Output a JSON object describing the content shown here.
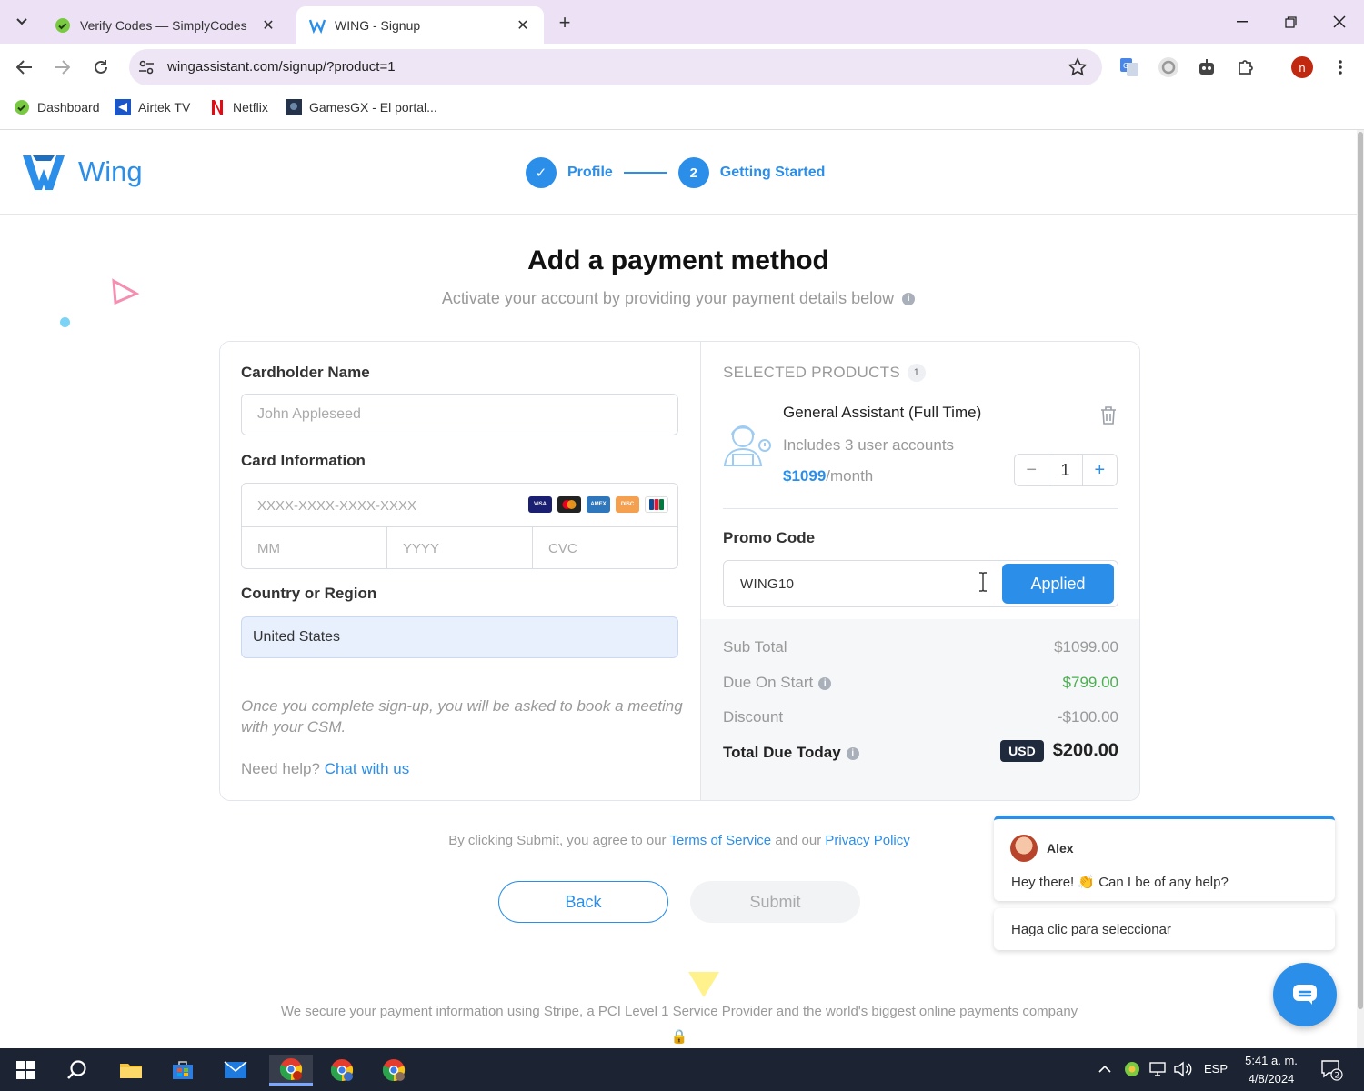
{
  "browser": {
    "tabs": [
      {
        "title": "Verify Codes — SimplyCodes",
        "active": false
      },
      {
        "title": "WING - Signup",
        "active": true
      }
    ],
    "url": "wingassistant.com/signup/?product=1",
    "profile_initial": "n",
    "bookmarks": [
      {
        "label": "Dashboard",
        "icon": "simplycodes-icon"
      },
      {
        "label": "Airtek TV",
        "icon": "airtek-icon"
      },
      {
        "label": "Netflix",
        "icon": "netflix-icon"
      },
      {
        "label": "GamesGX - El portal...",
        "icon": "gamesgx-icon"
      }
    ]
  },
  "header": {
    "brand": "Wing",
    "steps": [
      {
        "label": "Profile",
        "marker": "✓",
        "state": "done"
      },
      {
        "label": "Getting Started",
        "marker": "2",
        "state": "current"
      }
    ]
  },
  "main": {
    "title": "Add a payment method",
    "subtitle": "Activate your account by providing your payment details below",
    "info_glyph": "i"
  },
  "form": {
    "cardholder_label": "Cardholder Name",
    "cardholder_placeholder": "John Appleseed",
    "card_label": "Card Information",
    "card_number_placeholder": "XXXX-XXXX-XXXX-XXXX",
    "card_brands": [
      {
        "name": "VISA",
        "color": "#1a1f71"
      },
      {
        "name": "MC",
        "color": "#222222"
      },
      {
        "name": "AMEX",
        "color": "#2e77bc"
      },
      {
        "name": "DISC",
        "color": "#f5a04e"
      },
      {
        "name": "JCB",
        "color": "#ffffff"
      }
    ],
    "month_placeholder": "MM",
    "year_placeholder": "YYYY",
    "cvc_placeholder": "CVC",
    "country_label": "Country or Region",
    "country_value": "United States",
    "note": "Once you complete sign-up, you will be asked to book a meeting with your CSM.",
    "help_prefix": "Need help?",
    "help_link": "Chat with us"
  },
  "products": {
    "header": "SELECTED PRODUCTS",
    "count": "1",
    "items": [
      {
        "name": "General Assistant (Full Time)",
        "description": "Includes 3 user accounts",
        "price": "$1099",
        "period": "/month",
        "quantity": "1"
      }
    ],
    "qty_minus": "−",
    "qty_plus": "+"
  },
  "promo": {
    "label": "Promo Code",
    "value": "WING10",
    "button": "Applied"
  },
  "summary": {
    "subtotal_label": "Sub Total",
    "subtotal_value": "$1099.00",
    "due_label": "Due On Start",
    "due_value": "$799.00",
    "discount_label": "Discount",
    "discount_value": "-$100.00",
    "total_label": "Total Due Today",
    "currency": "USD",
    "total_value": "$200.00"
  },
  "footer": {
    "agree_prefix": "By clicking Submit, you agree to our",
    "terms": "Terms of Service",
    "agree_mid": "and our",
    "privacy": "Privacy Policy",
    "back": "Back",
    "submit": "Submit",
    "secure": "We secure your payment information using Stripe, a PCI Level 1 Service Provider and the world's biggest online payments company"
  },
  "chat": {
    "agent": "Alex",
    "message": "Hey there! 👏 Can I be of any help?",
    "select_prompt": "Haga clic para seleccionar"
  },
  "taskbar": {
    "language": "ESP",
    "time": "5:41 a. m.",
    "date": "4/8/2024",
    "notifications": "2"
  },
  "colors": {
    "accent": "#2b8ee8",
    "due_green": "#4caf50",
    "usd_badge": "#1f2a3c"
  }
}
